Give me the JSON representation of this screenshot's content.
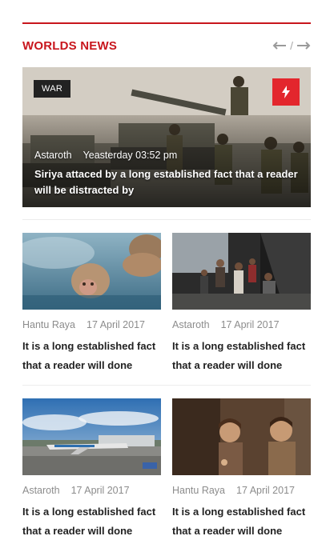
{
  "section": {
    "title": "WORLDS NEWS",
    "nav_separator": "/"
  },
  "feature": {
    "category": "WAR",
    "author": "Astaroth",
    "time": "Yeasterday 03:52 pm",
    "title": "Siriya attaced by a long established fact that a reader will be distracted by",
    "icon": "lightning-icon"
  },
  "cards": [
    {
      "author": "Hantu Raya",
      "date": "17 April 2017",
      "title": "It is a long established fact that a reader will done",
      "image": "monkey-hot-spring"
    },
    {
      "author": "Astaroth",
      "date": "17 April 2017",
      "title": "It is a long established fact that a reader will done",
      "image": "refugee-crowd"
    },
    {
      "author": "Astaroth",
      "date": "17 April 2017",
      "title": "It is a long established fact that a reader will done",
      "image": "airport-runway"
    },
    {
      "author": "Hantu Raya",
      "date": "17 April 2017",
      "title": "It is a long established fact that a reader will done",
      "image": "children-portrait"
    }
  ],
  "colors": {
    "accent": "#c8161d",
    "flash": "#e3262d"
  }
}
